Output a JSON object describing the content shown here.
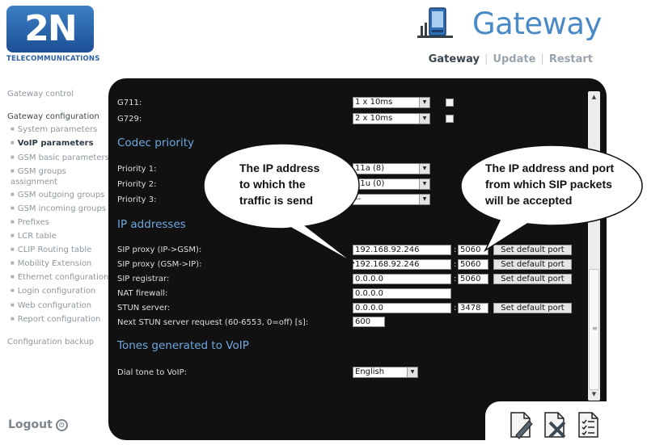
{
  "logo": {
    "mark": "2N",
    "subtitle": "TELECOMMUNICATIONS"
  },
  "header": {
    "title": "Gateway",
    "nav": [
      {
        "label": "Gateway",
        "active": true
      },
      {
        "label": "Update",
        "active": false
      },
      {
        "label": "Restart",
        "active": false
      }
    ]
  },
  "sidebar": {
    "gateway_control": "Gateway control",
    "gateway_configuration": "Gateway configuration",
    "items": [
      {
        "label": "System parameters"
      },
      {
        "label": "VoIP parameters"
      },
      {
        "label": "GSM basic parameters"
      },
      {
        "label": "GSM groups assignment"
      },
      {
        "label": "GSM outgoing groups"
      },
      {
        "label": "GSM incoming groups"
      },
      {
        "label": "Prefixes"
      },
      {
        "label": "LCR table"
      },
      {
        "label": "CLIP Routing table"
      },
      {
        "label": "Mobility Extension"
      },
      {
        "label": "Ethernet configuration"
      },
      {
        "label": "Login configuration"
      },
      {
        "label": "Web configuration"
      },
      {
        "label": "Report configuration"
      }
    ],
    "configuration_backup": "Configuration backup",
    "logout": "Logout"
  },
  "codecs": {
    "g711_label": "G711:",
    "g711_value": "1 x 10ms",
    "g729_label": "G729:",
    "g729_value": "2 x 10ms"
  },
  "codec_priority": {
    "title": "Codec priority",
    "p1_label": "Priority 1:",
    "p1_value": "11a (8)",
    "p2_label": "Priority 2:",
    "p2_value": "11u (0)",
    "p3_label": "Priority 3:",
    "p3_value": "--"
  },
  "ip_addresses": {
    "title": "IP addresses",
    "sip_proxy_ip_gsm_label": "SIP proxy (IP->GSM):",
    "sip_proxy_ip_gsm_value": "192.168.92.246",
    "sip_proxy_ip_gsm_port": "5060",
    "sip_proxy_gsm_ip_label": "SIP proxy (GSM->IP):",
    "sip_proxy_gsm_ip_value": "192.168.92.246",
    "sip_proxy_gsm_ip_port": "5060",
    "sip_registrar_label": "SIP registrar:",
    "sip_registrar_value": "0.0.0.0",
    "sip_registrar_port": "5060",
    "nat_firewall_label": "NAT firewall:",
    "nat_firewall_value": "0.0.0.0",
    "stun_server_label": "STUN server:",
    "stun_server_value": "0.0.0.0",
    "stun_server_port": "3478",
    "stun_request_label": "Next STUN server request (60-6553, 0=off) [s]:",
    "stun_request_value": "600",
    "set_default_port_label": "Set default port",
    "colon": ":"
  },
  "tones": {
    "title": "Tones generated to VoIP",
    "dial_tone_label": "Dial tone to VoIP:",
    "dial_tone_value": "English"
  },
  "callouts": {
    "left_text": "The IP address to which the traffic is send",
    "left_lines": [
      "The IP address",
      "to which the",
      "traffic is send"
    ],
    "right_lines": [
      "The IP address and port",
      "from which SIP packets",
      "will be accepted"
    ]
  },
  "icons": {
    "brand": "gateway-device-icon",
    "logout": "power-icon",
    "action_1": "save-document-icon",
    "action_2": "cancel-document-icon",
    "action_3": "checklist-document-icon"
  },
  "colors": {
    "panel": "#111111",
    "section_title": "#6fa8e0",
    "brand": "#4a8ac6"
  }
}
